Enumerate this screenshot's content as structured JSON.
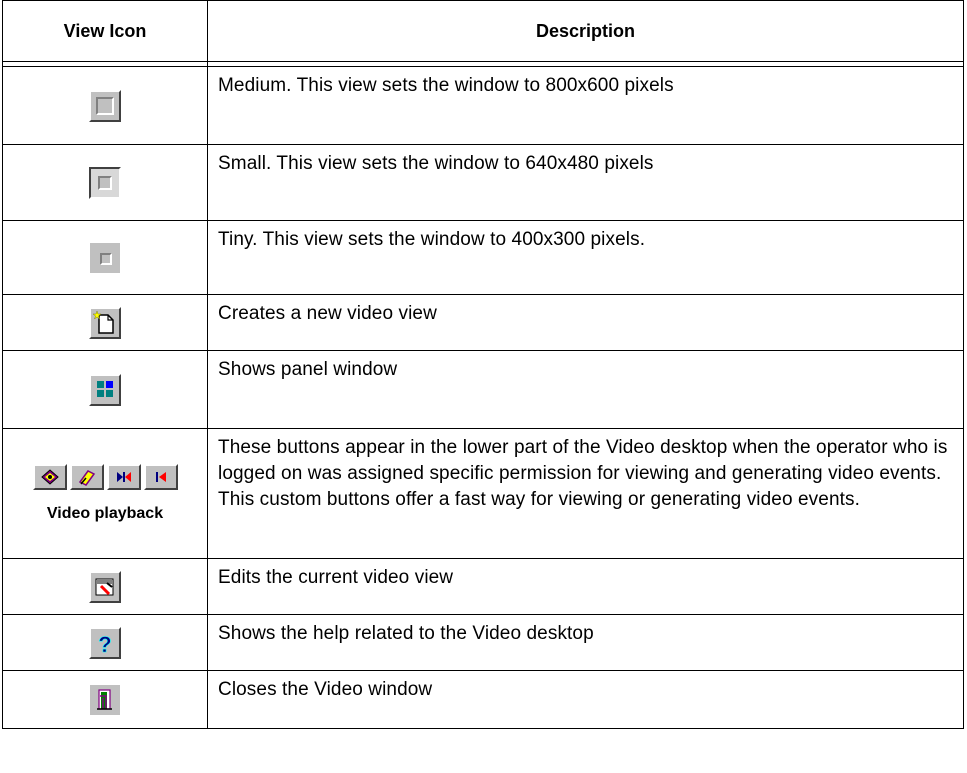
{
  "table": {
    "headers": {
      "icon": "View Icon",
      "description": "Description"
    },
    "rows": [
      {
        "icon": "medium-view-icon",
        "description": "Medium. This view sets the window to 800x600 pixels"
      },
      {
        "icon": "small-view-icon",
        "description": "Small. This view sets the window to 640x480 pixels"
      },
      {
        "icon": "tiny-view-icon",
        "description": "Tiny. This view sets the window to 400x300 pixels."
      },
      {
        "icon": "new-video-view-icon",
        "description": "Creates a new video view"
      },
      {
        "icon": "panel-window-icon",
        "description": "Shows panel window"
      },
      {
        "icon": "video-playback-buttons",
        "icon_label": "Video playback",
        "description": "These buttons appear in the lower part of the Video desktop when the operator who is logged on was assigned specific permission for viewing and generating video events. This custom buttons offer a fast way for viewing or generating video events."
      },
      {
        "icon": "edit-video-view-icon",
        "description": "Edits the current video view"
      },
      {
        "icon": "help-icon",
        "description": "Shows the help related to the Video desktop"
      },
      {
        "icon": "close-window-icon",
        "description": "Closes the Video window"
      }
    ]
  }
}
